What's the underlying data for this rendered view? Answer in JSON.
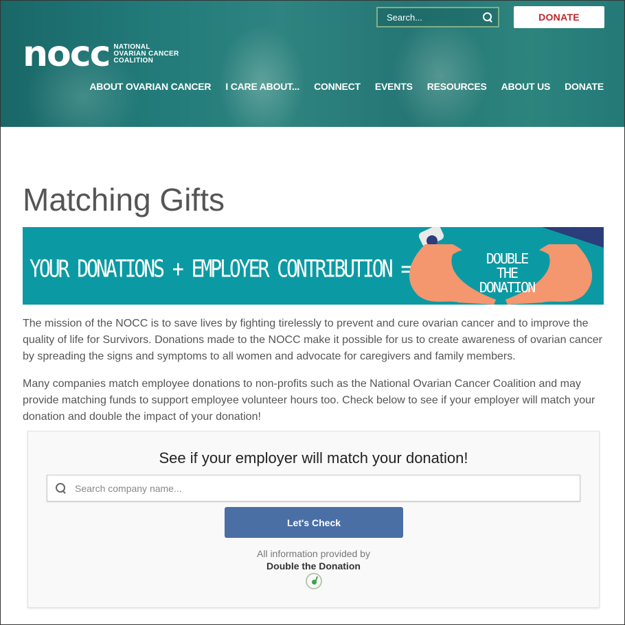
{
  "header": {
    "logo_mark": "nocc",
    "logo_text_lines": [
      "NATIONAL",
      "OVARIAN CANCER",
      "COALITION"
    ],
    "search_placeholder": "Search...",
    "donate_button": "DONATE",
    "nav": [
      {
        "label": "ABOUT OVARIAN CANCER"
      },
      {
        "label": "I CARE ABOUT..."
      },
      {
        "label": "CONNECT"
      },
      {
        "label": "EVENTS"
      },
      {
        "label": "RESOURCES"
      },
      {
        "label": "ABOUT US"
      },
      {
        "label": "DONATE"
      }
    ]
  },
  "main": {
    "title": "Matching Gifts",
    "banner": {
      "text": "YOUR DONATIONS + EMPLOYER CONTRIBUTION =",
      "heart_text": "DOUBLE THE DONATION"
    },
    "paragraphs": [
      "The mission of the NOCC is to save lives by fighting tirelessly to prevent and cure ovarian cancer and to improve the quality of life for Survivors. Donations made to the NOCC make it possible for us to create awareness of ovarian cancer by spreading the signs and symptoms to all women and advocate for caregivers and family members.",
      "Many companies match employee donations to non-profits such as the National Ovarian Cancer Coalition and may provide matching funds to support employee volunteer hours too. Check below to see if your employer will match your donation and double the impact of your donation!"
    ]
  },
  "widget": {
    "title": "See if your employer will match your donation!",
    "search_placeholder": "Search company name...",
    "button": "Let's Check",
    "provided_by": "All information provided by",
    "provider": "Double the Donation"
  },
  "colors": {
    "brand_teal": "#0b9aa3",
    "donate_red": "#c0242a",
    "button_blue": "#4a6fa5"
  }
}
